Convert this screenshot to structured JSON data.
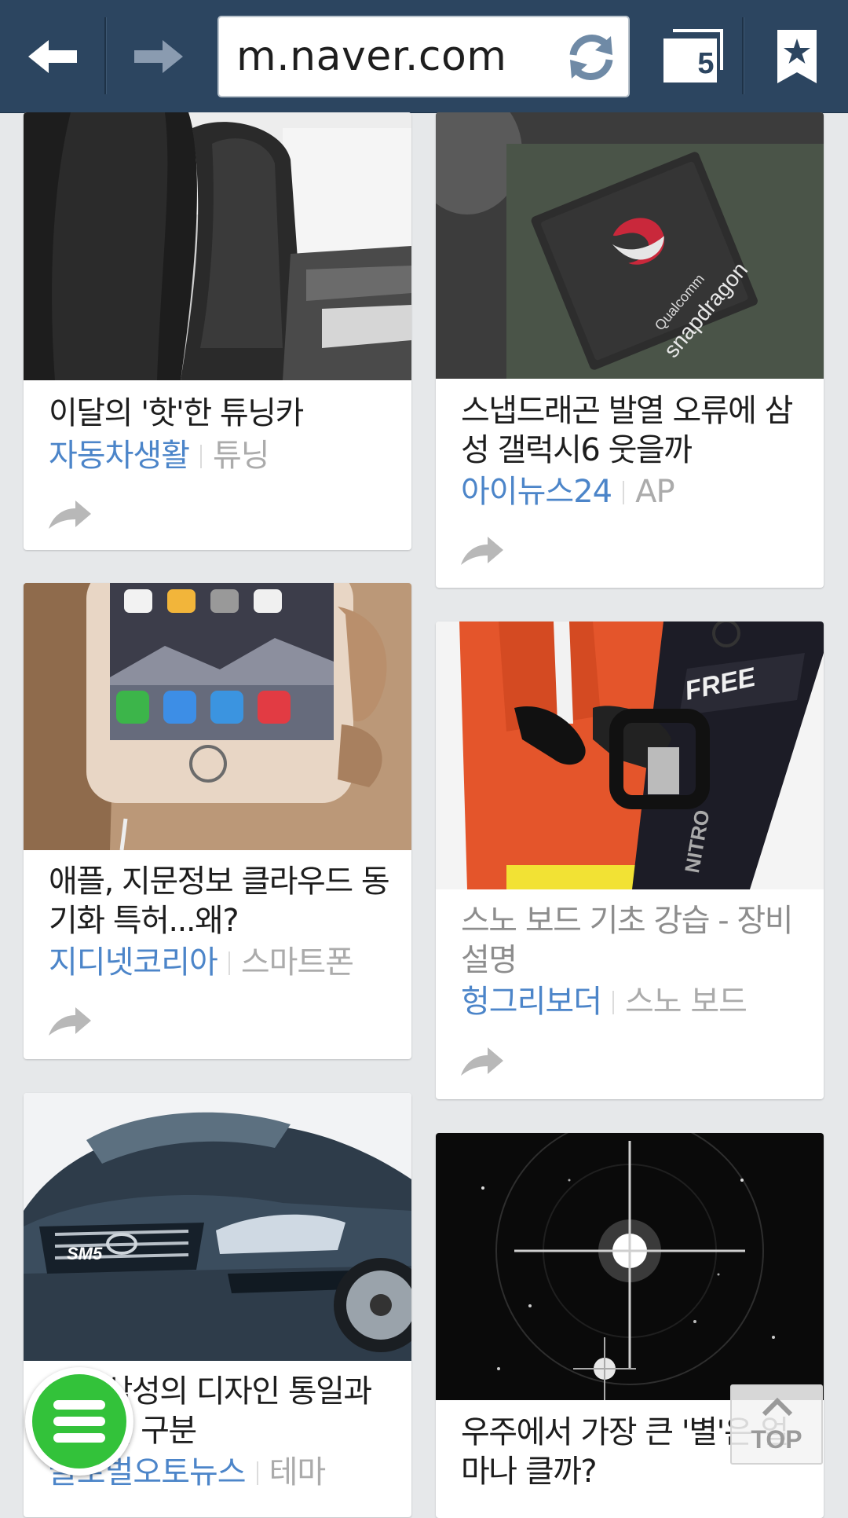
{
  "browser": {
    "url": "m.naver.com",
    "tab_count": "5"
  },
  "cards": [
    {
      "title": "이달의 '핫'한 튜닝카",
      "source": "자동차생활",
      "category": "튜닝"
    },
    {
      "title": "스냅드래곤 발열 오류에 삼성 갤럭시6 웃을까",
      "source": "아이뉴스24",
      "category": "AP"
    },
    {
      "title": "애플, 지문정보 클라우드 동기화 특허...왜?",
      "source": "지디넷코리아",
      "category": "스마트폰"
    },
    {
      "title": "스노 보드 기초 강습 - 장비 설명",
      "source": "헝그리보더",
      "category": "스노 보드"
    },
    {
      "title": "르노삼성의 디자인 통일과 이미지 구분",
      "source": "글로벌오토뉴스",
      "category": "테마"
    },
    {
      "title": "우주에서 가장 큰 '별'은 얼마나 클까?",
      "source": "",
      "category": ""
    }
  ],
  "top_button": {
    "label": "TOP"
  },
  "colors": {
    "toolbar": "#2c4560",
    "source_link": "#4c85c9",
    "menu_fab": "#33c23a"
  }
}
